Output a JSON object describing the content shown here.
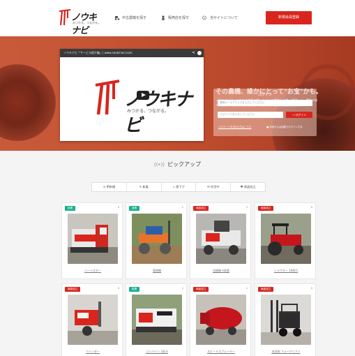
{
  "header": {
    "logo_text": "ノウキナビ",
    "logo_tagline": "みつかる、つながる。",
    "nav": [
      {
        "label": "中古農機を探す",
        "icon": "tractor-icon"
      },
      {
        "label": "販売店を探す",
        "icon": "person-icon"
      },
      {
        "label": "当サイトについて",
        "icon": "info-icon"
      }
    ],
    "register_label": "新規会員登録"
  },
  "hero": {
    "video_title": "ノウキナビ「サービス紹介編」| www.noukinavi.com",
    "video_logo_text": "ノウキナビ",
    "video_tagline": "みつかる、つながる。",
    "headline": "その農機、誰かにとって\"お宝\"かも。",
    "description": "ノウキナビは、あなたの倉庫で眠ったままの農機を市場へ橋渡しし、農機の新たな活躍の場とそれによる農機の活性化を、全面的に支援します。",
    "login": {
      "title": "ログイン",
      "email_placeholder": "登録メールアドレスを入力してください",
      "password_placeholder": "パスワードを入力してください",
      "button_label": "ログイン",
      "forgot_label": "パスワードを忘れた方はこちら",
      "remember_label": "次回からは自動でログインする"
    }
  },
  "pickup": {
    "title": "ピックアップ",
    "tabs": [
      {
        "label": "更新順",
        "icon": "clock-icon"
      },
      {
        "label": "新着",
        "icon": "pencil-icon"
      },
      {
        "label": "値下げ",
        "icon": "down-icon"
      },
      {
        "label": "交渉中",
        "icon": "chat-icon"
      },
      {
        "label": "商談成立",
        "icon": "handshake-icon"
      }
    ],
    "items": [
      {
        "badge": "新着",
        "badge_type": "new",
        "count": "0",
        "caption": "ハーベスター"
      },
      {
        "badge": "新着",
        "badge_type": "new",
        "count": "1",
        "caption": "管理機"
      },
      {
        "badge": "商談成立",
        "badge_type": "sold",
        "count": "2",
        "caption": "田植機 4条植"
      },
      {
        "badge": "商談成立",
        "badge_type": "sold",
        "count": "0",
        "caption": "トラクター 18馬力"
      },
      {
        "badge": "商談成立",
        "badge_type": "sold",
        "count": "0",
        "caption": "バインダー"
      },
      {
        "badge": "新着",
        "badge_type": "new",
        "count": "1",
        "caption": "コンバイン 2条刈"
      },
      {
        "badge": "商談成立",
        "badge_type": "sold",
        "count": "1",
        "caption": "スピードスプレーヤー"
      },
      {
        "badge": "商談成立",
        "badge_type": "sold",
        "count": "0",
        "caption": "本田他 フォークリフト"
      }
    ]
  }
}
